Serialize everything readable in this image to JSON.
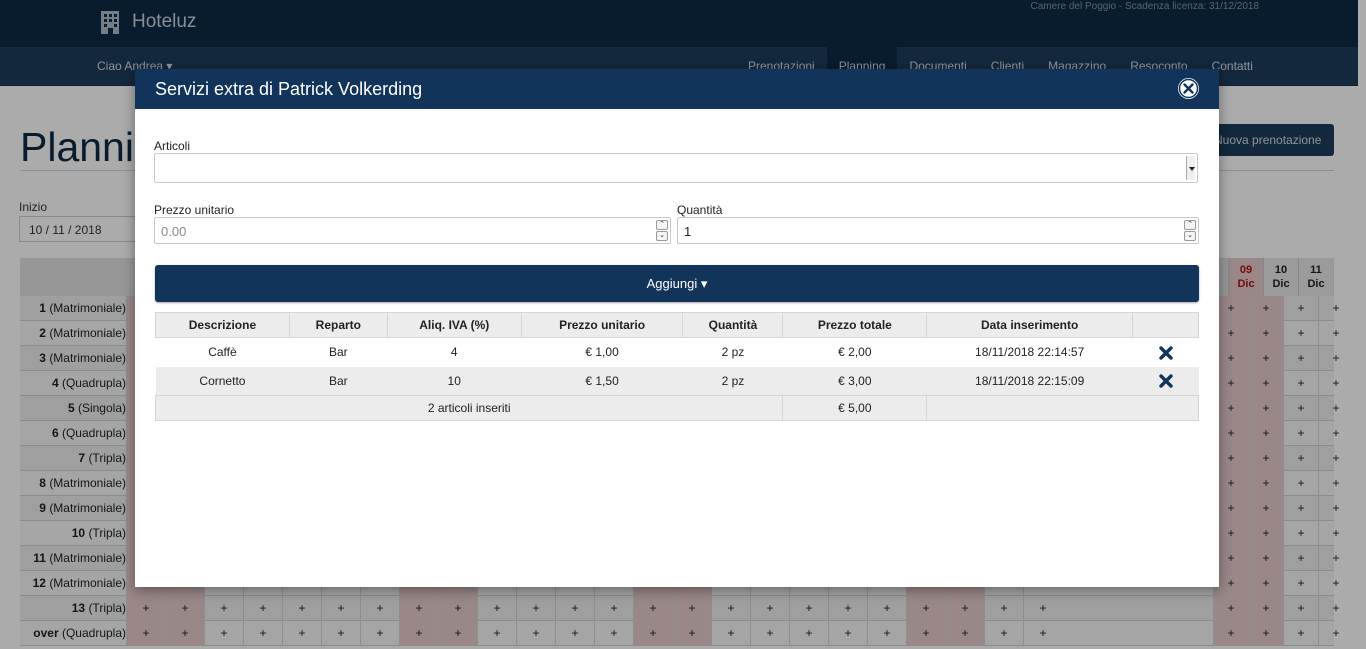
{
  "app": {
    "brand": "Hoteluz",
    "license": "Camere del Poggio - Scadenza licenza: 31/12/2018",
    "greeting": "Ciao Andrea ▾",
    "nav": [
      "Prenotazioni",
      "Planning",
      "Documenti",
      "Clienti",
      "Magazzino",
      "Resoconto",
      "Contatti"
    ],
    "active_nav": "Planning",
    "page_title": "Planning",
    "new_booking": "Nuova prenotazione",
    "start_label": "Inizio",
    "start_value": "10 / 11 / 2018"
  },
  "planning": {
    "days_visible": [
      {
        "num": "09",
        "mon": "Dic",
        "sunday": true
      },
      {
        "num": "10",
        "mon": "Dic",
        "sunday": false
      },
      {
        "num": "11",
        "mon": "Dic",
        "sunday": false
      }
    ],
    "rooms": [
      {
        "num": "1",
        "type": "(Matrimoniale)"
      },
      {
        "num": "2",
        "type": "(Matrimoniale)"
      },
      {
        "num": "3",
        "type": "(Matrimoniale)"
      },
      {
        "num": "4",
        "type": "(Quadrupla)"
      },
      {
        "num": "5",
        "type": "(Singola)"
      },
      {
        "num": "6",
        "type": "(Quadrupla)"
      },
      {
        "num": "7",
        "type": "(Tripla)"
      },
      {
        "num": "8",
        "type": "(Matrimoniale)"
      },
      {
        "num": "9",
        "type": "(Matrimoniale)"
      },
      {
        "num": "10",
        "type": "(Tripla)"
      },
      {
        "num": "11",
        "type": "(Matrimoniale)"
      },
      {
        "num": "12",
        "type": "(Matrimoniale)"
      },
      {
        "num": "13",
        "type": "(Tripla)"
      },
      {
        "num": "over",
        "type": "(Quadrupla)"
      }
    ],
    "cell_symbol": "+"
  },
  "modal": {
    "title": "Servizi extra di Patrick Volkerding",
    "articoli_label": "Articoli",
    "articoli_value": "",
    "prezzo_label": "Prezzo unitario",
    "prezzo_placeholder": "0.00",
    "quantita_label": "Quantità",
    "quantita_value": "1",
    "add_button": "Aggiungi ▾",
    "columns": [
      "Descrizione",
      "Reparto",
      "Aliq. IVA (%)",
      "Prezzo unitario",
      "Quantità",
      "Prezzo totale",
      "Data inserimento"
    ],
    "rows": [
      {
        "descrizione": "Caffè",
        "reparto": "Bar",
        "iva": "4",
        "prezzo": "€ 1,00",
        "quantita": "2 pz",
        "totale": "€ 2,00",
        "data": "18/11/2018 22:14:57"
      },
      {
        "descrizione": "Cornetto",
        "reparto": "Bar",
        "iva": "10",
        "prezzo": "€ 1,50",
        "quantita": "2 pz",
        "totale": "€ 3,00",
        "data": "18/11/2018 22:15:09"
      }
    ],
    "footer_count": "2 articoli inseriti",
    "footer_total": "€ 5,00"
  },
  "colors": {
    "primary": "#12335a",
    "delete_icon": "#12335a",
    "sunday": "#b0101a"
  }
}
